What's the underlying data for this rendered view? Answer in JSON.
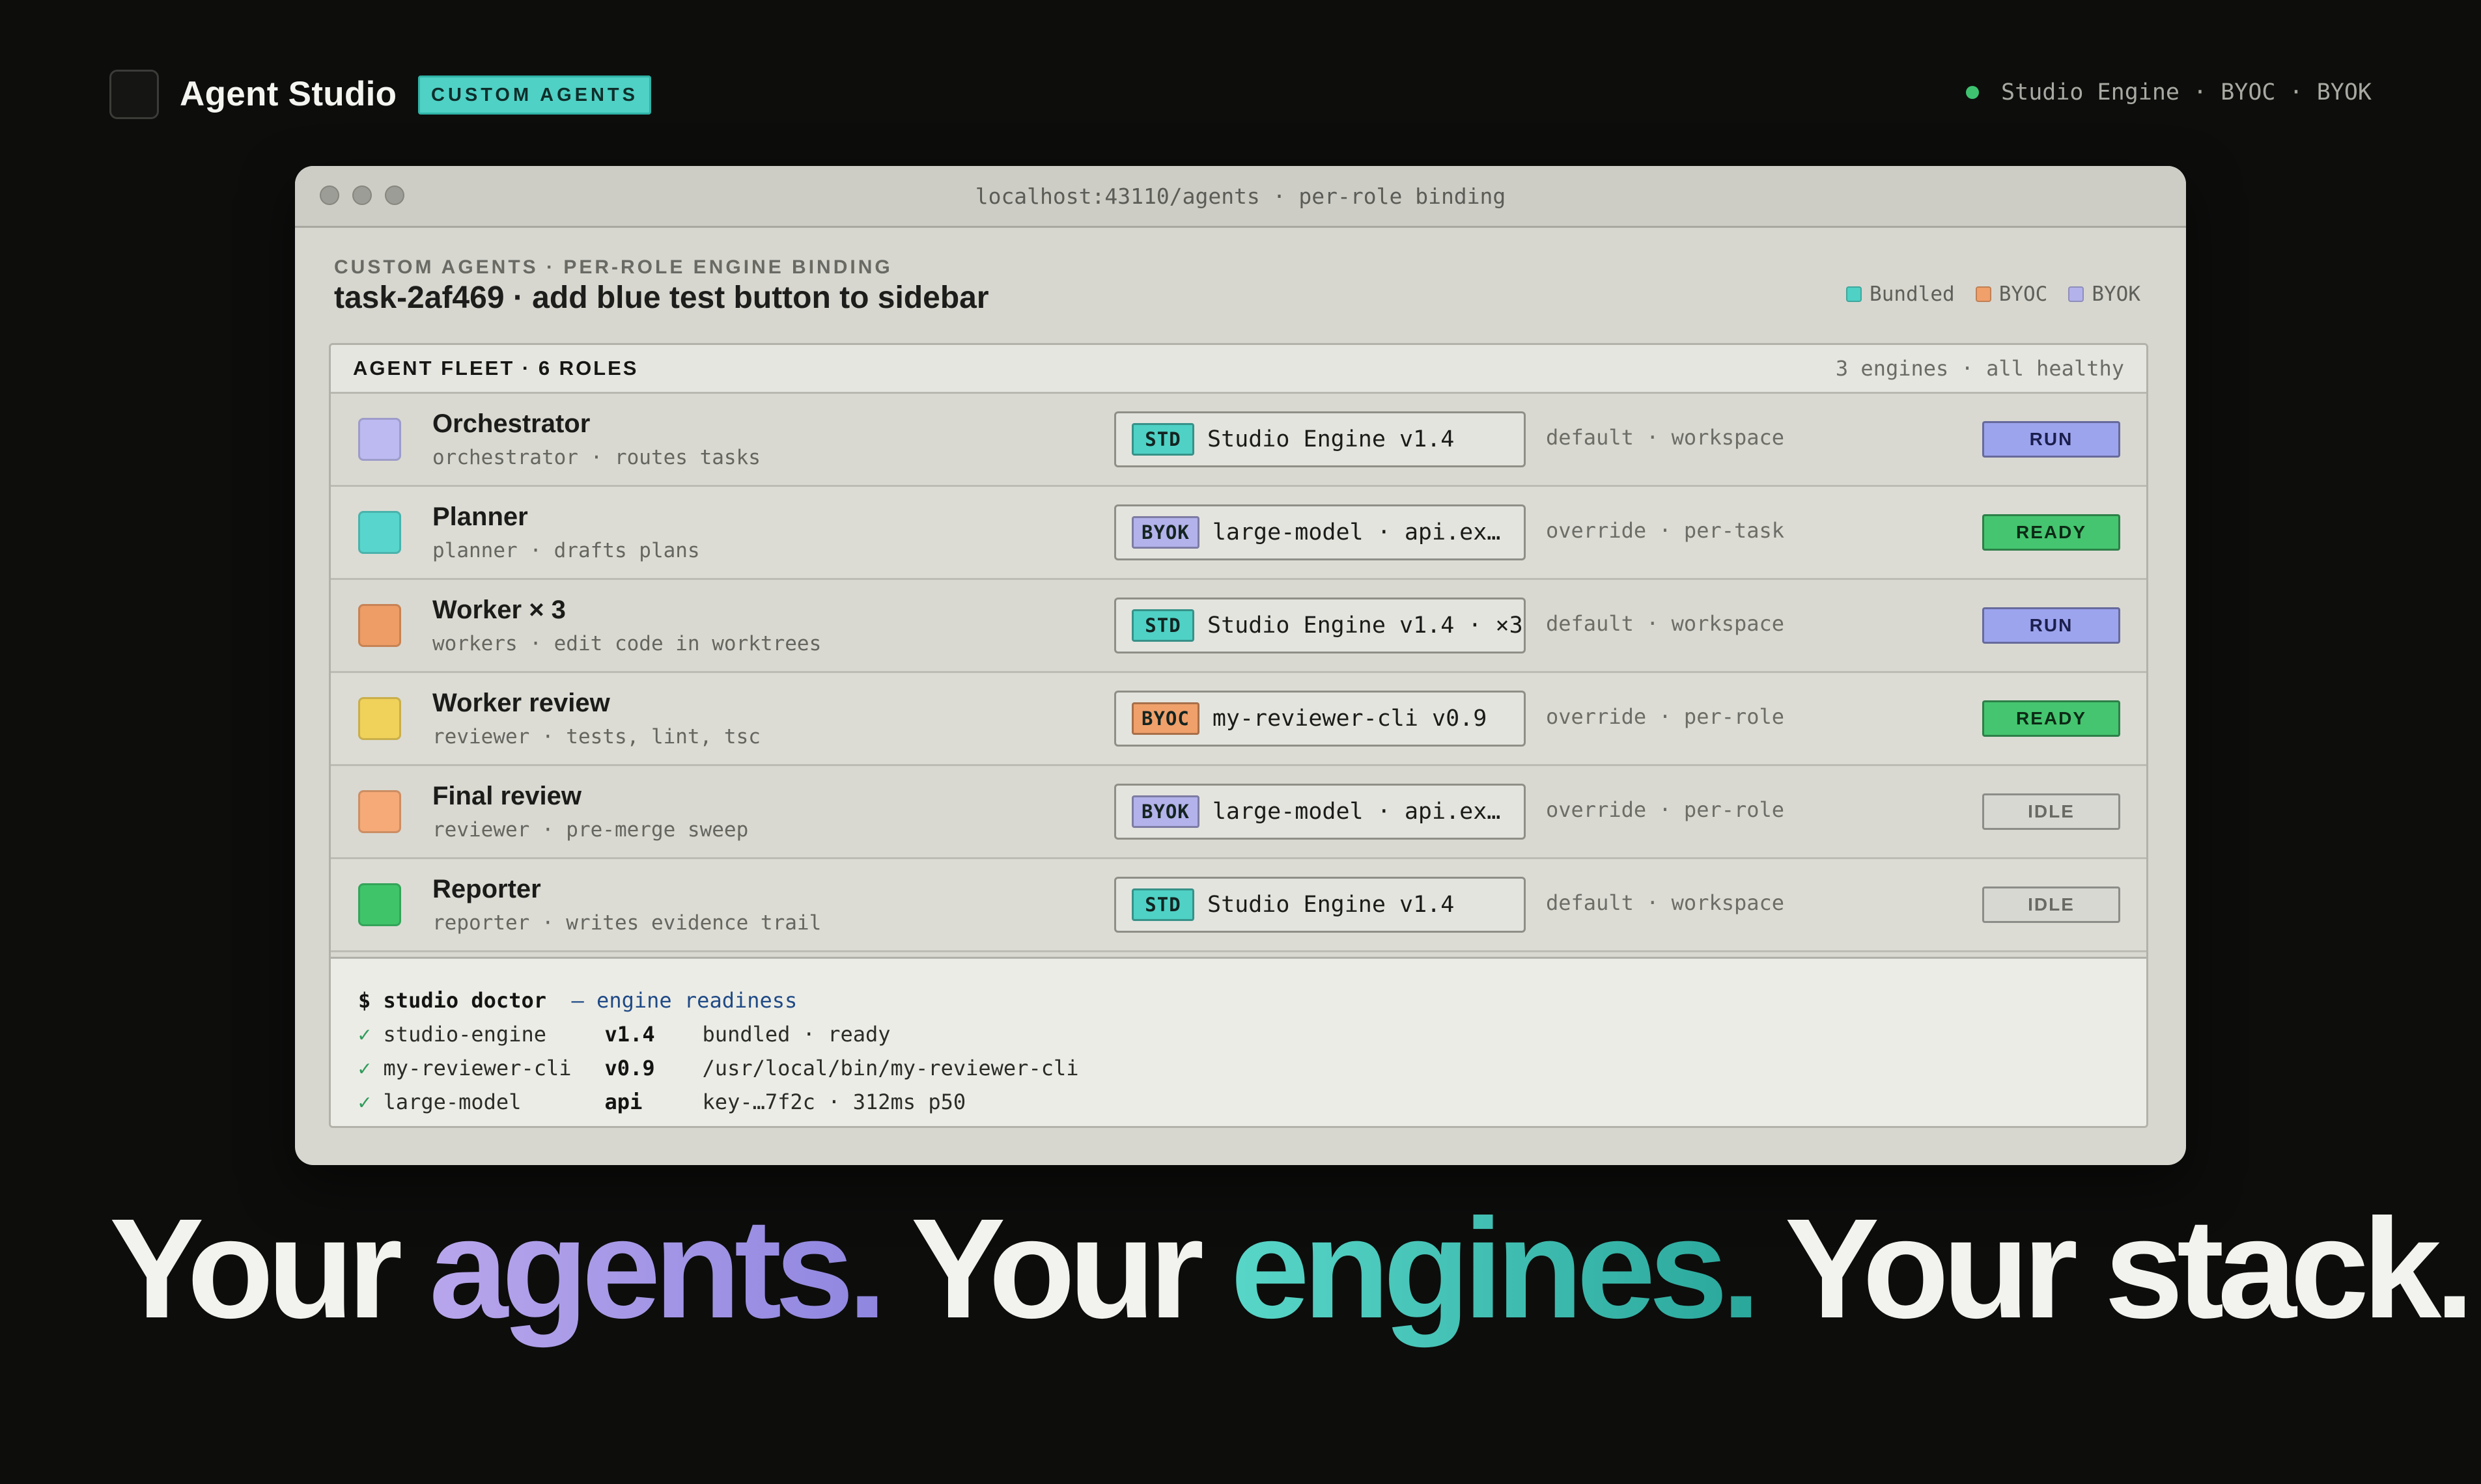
{
  "header": {
    "app_title": "Agent Studio",
    "badge": "CUSTOM AGENTS",
    "engine_status": "Studio Engine · BYOC · BYOK",
    "status_color": "#3ec270"
  },
  "browser": {
    "url": "localhost:43110/agents · per-role binding"
  },
  "page": {
    "eyebrow": "CUSTOM AGENTS · PER-ROLE ENGINE BINDING",
    "title": "task-2af469 · add blue test button to sidebar",
    "legend": [
      {
        "label": "Bundled",
        "color": "#4fd1c5"
      },
      {
        "label": "BYOC",
        "color": "#f0a06a"
      },
      {
        "label": "BYOK",
        "color": "#b3b2ea"
      }
    ]
  },
  "fleet": {
    "title": "AGENT FLEET · 6 ROLES",
    "meta": "3 engines · all healthy",
    "rows": [
      {
        "name": "Orchestrator",
        "sub": "orchestrator · routes tasks",
        "icon_color": "#bcbaf0",
        "engine_tag": "STD",
        "engine_tag_color": "#4fd1c5",
        "engine": "Studio Engine v1.4",
        "binding": "default · workspace",
        "state": "RUN",
        "state_bg": "#9da4ee",
        "state_fg": "#1b1f4d"
      },
      {
        "name": "Planner",
        "sub": "planner · drafts plans",
        "icon_color": "#58d6cd",
        "engine_tag": "BYOK",
        "engine_tag_color": "#b3b2ea",
        "engine": "large-model · api.ex…",
        "binding": "override · per-task",
        "state": "READY",
        "state_bg": "#45c56f",
        "state_fg": "#0c2a16"
      },
      {
        "name": "Worker × 3",
        "sub": "workers · edit code in worktrees",
        "icon_color": "#ee9d66",
        "engine_tag": "STD",
        "engine_tag_color": "#4fd1c5",
        "engine": "Studio Engine v1.4 · ×3",
        "binding": "default · workspace",
        "state": "RUN",
        "state_bg": "#9da4ee",
        "state_fg": "#1b1f4d"
      },
      {
        "name": "Worker review",
        "sub": "reviewer · tests, lint, tsc",
        "icon_color": "#f0d15a",
        "engine_tag": "BYOC",
        "engine_tag_color": "#f0a06a",
        "engine": "my-reviewer-cli v0.9",
        "binding": "override · per-role",
        "state": "READY",
        "state_bg": "#45c56f",
        "state_fg": "#0c2a16"
      },
      {
        "name": "Final review",
        "sub": "reviewer · pre-merge sweep",
        "icon_color": "#f5aa78",
        "engine_tag": "BYOK",
        "engine_tag_color": "#b3b2ea",
        "engine": "large-model · api.ex…",
        "binding": "override · per-role",
        "state": "IDLE",
        "state_bg": "#d8d8d2",
        "state_fg": "#6a6a64"
      },
      {
        "name": "Reporter",
        "sub": "reporter · writes evidence trail",
        "icon_color": "#40c46a",
        "engine_tag": "STD",
        "engine_tag_color": "#4fd1c5",
        "engine": "Studio Engine v1.4",
        "binding": "default · workspace",
        "state": "IDLE",
        "state_bg": "#d8d8d2",
        "state_fg": "#6a6a64"
      }
    ]
  },
  "terminal": {
    "prompt": "$ studio doctor",
    "note": "— engine readiness",
    "checks": [
      {
        "mark": "✓",
        "name": "studio-engine",
        "version": "v1.4",
        "detail": "bundled · ready"
      },
      {
        "mark": "✓",
        "name": "my-reviewer-cli",
        "version": "v0.9",
        "detail": "/usr/local/bin/my-reviewer-cli"
      },
      {
        "mark": "✓",
        "name": "large-model",
        "version": "api",
        "detail": "key-…7f2c · 312ms p50"
      }
    ]
  },
  "hero": {
    "p1": "Your ",
    "p2": "agents.",
    "p3": " Your ",
    "p4": "engines.",
    "p5": " Your stack."
  }
}
